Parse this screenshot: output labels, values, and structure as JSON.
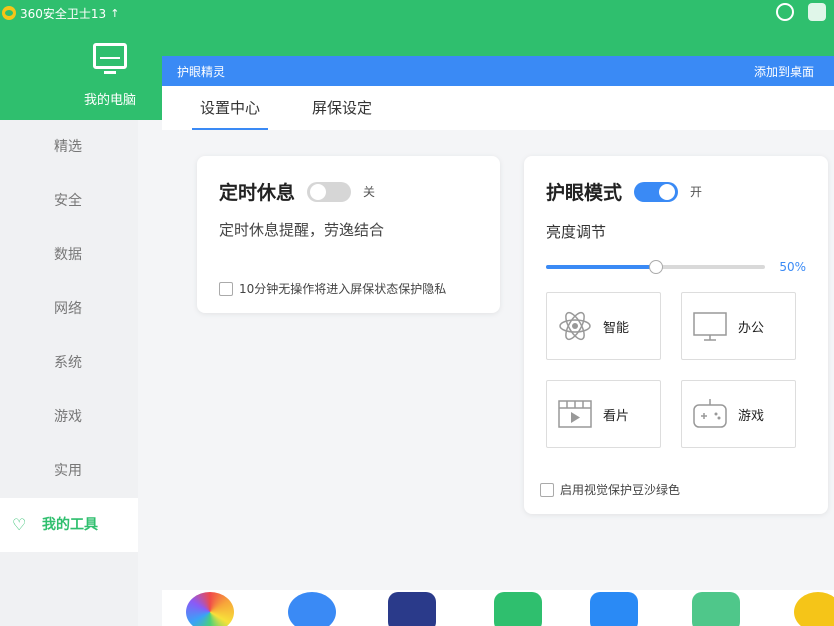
{
  "app": {
    "title": "360安全卫士13"
  },
  "colors": {
    "green": "#2fbf6e",
    "blue": "#3a8af5"
  },
  "top_nav": {
    "current_label": "我的电脑"
  },
  "sidebar": {
    "items": [
      {
        "label": "精选"
      },
      {
        "label": "安全"
      },
      {
        "label": "数据"
      },
      {
        "label": "网络"
      },
      {
        "label": "系统"
      },
      {
        "label": "游戏"
      },
      {
        "label": "实用"
      },
      {
        "label": "我的工具",
        "active": true
      }
    ]
  },
  "panel": {
    "title": "护眼精灵",
    "add_to_desktop": "添加到桌面",
    "tabs": [
      {
        "label": "设置中心",
        "active": true
      },
      {
        "label": "屏保设定",
        "active": false
      }
    ],
    "rest_card": {
      "title": "定时休息",
      "toggle_state_label": "关",
      "toggle_on": false,
      "description": "定时休息提醒，劳逸结合",
      "checkbox_label": "10分钟无操作将进入屏保状态保护隐私",
      "checkbox_checked": false
    },
    "eye_card": {
      "title": "护眼模式",
      "toggle_state_label": "开",
      "toggle_on": true,
      "brightness_label": "亮度调节",
      "brightness_value": 50,
      "brightness_text": "50%",
      "modes": [
        {
          "label": "智能",
          "icon": "atom-icon"
        },
        {
          "label": "办公",
          "icon": "monitor-icon"
        },
        {
          "label": "看片",
          "icon": "film-icon"
        },
        {
          "label": "游戏",
          "icon": "gamepad-icon"
        }
      ],
      "checkbox_label": "启用视觉保护豆沙绿色",
      "checkbox_checked": false
    }
  }
}
